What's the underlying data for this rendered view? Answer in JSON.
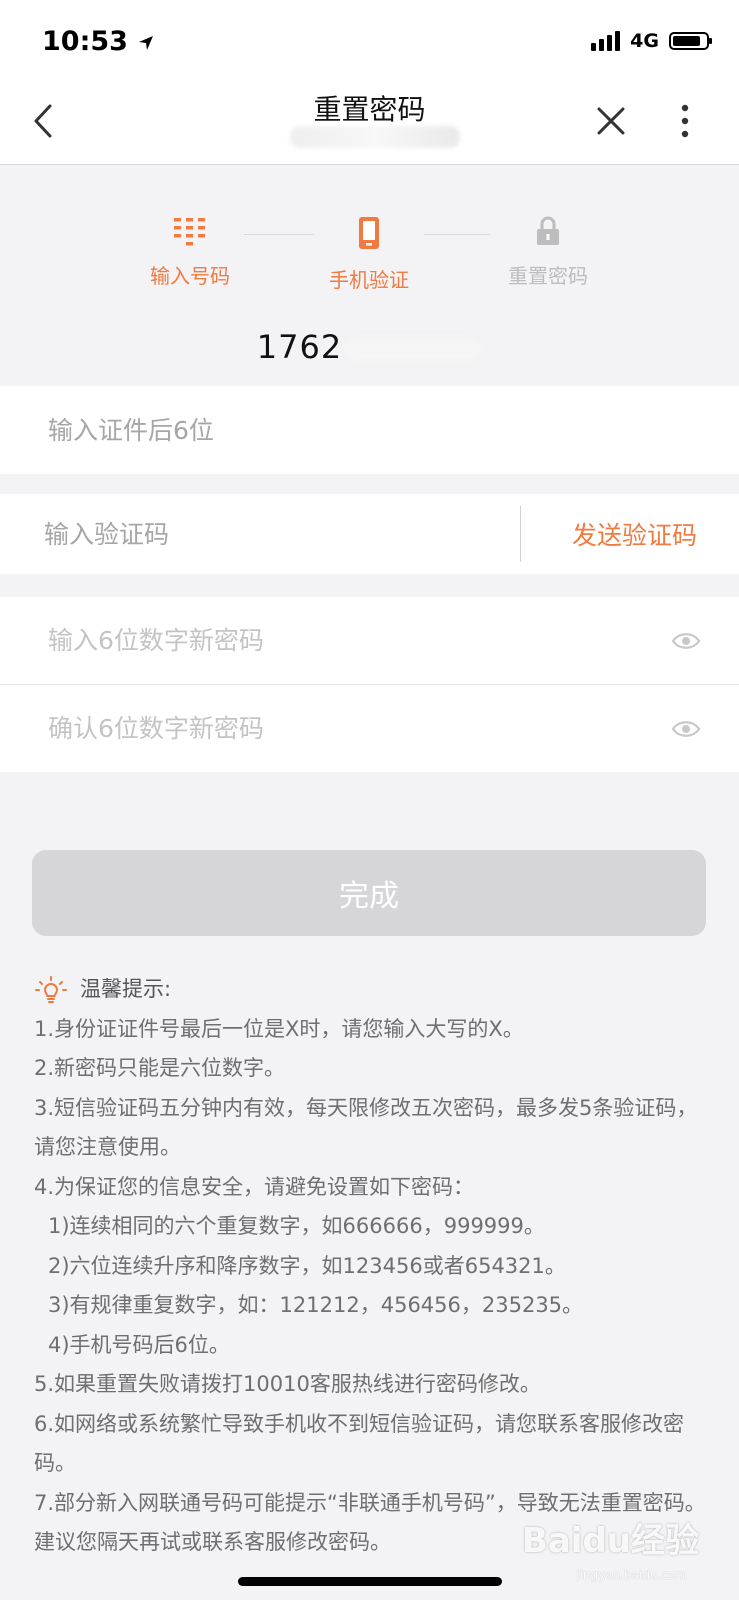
{
  "status_bar": {
    "time": "10:53",
    "network": "4G"
  },
  "nav": {
    "title": "重置密码"
  },
  "steps": [
    {
      "label": "输入号码",
      "icon": "keypad-icon",
      "state": "done"
    },
    {
      "label": "手机验证",
      "icon": "phone-icon",
      "state": "active"
    },
    {
      "label": "重置密码",
      "icon": "lock-icon",
      "state": "pending"
    }
  ],
  "phone_number_prefix": "1762",
  "form": {
    "id_placeholder": "输入证件后6位",
    "code_placeholder": "输入验证码",
    "send_code_label": "发送验证码",
    "new_password_placeholder": "输入6位数字新密码",
    "confirm_password_placeholder": "确认6位数字新密码"
  },
  "submit_label": "完成",
  "tips": {
    "title": "温馨提示:",
    "items": [
      "1.身份证证件号最后一位是X时，请您输入大写的X。",
      "2.新密码只能是六位数字。",
      "3.短信验证码五分钟内有效，每天限修改五次密码，最多发5条验证码，请您注意使用。",
      "4.为保证您的信息安全，请避免设置如下密码：",
      "1)连续相同的六个重复数字，如666666，999999。",
      "2)六位连续升序和降序数字，如123456或者654321。",
      "3)有规律重复数字，如：121212，456456，235235。",
      "4)手机号码后6位。",
      "5.如果重置失败请拨打10010客服热线进行密码修改。",
      "6.如网络或系统繁忙导致手机收不到短信验证码，请您联系客服修改密码。",
      "7.部分新入网联通号码可能提示“非联通手机号码”，导致无法重置密码。建议您隔天再试或联系客服修改密码。"
    ]
  },
  "colors": {
    "accent": "#f07a40",
    "inactive": "#bdbdbd",
    "background": "#f3f2f4"
  },
  "watermark": {
    "text": "Baidu经验",
    "sub": "jingyan.baidu.com"
  }
}
